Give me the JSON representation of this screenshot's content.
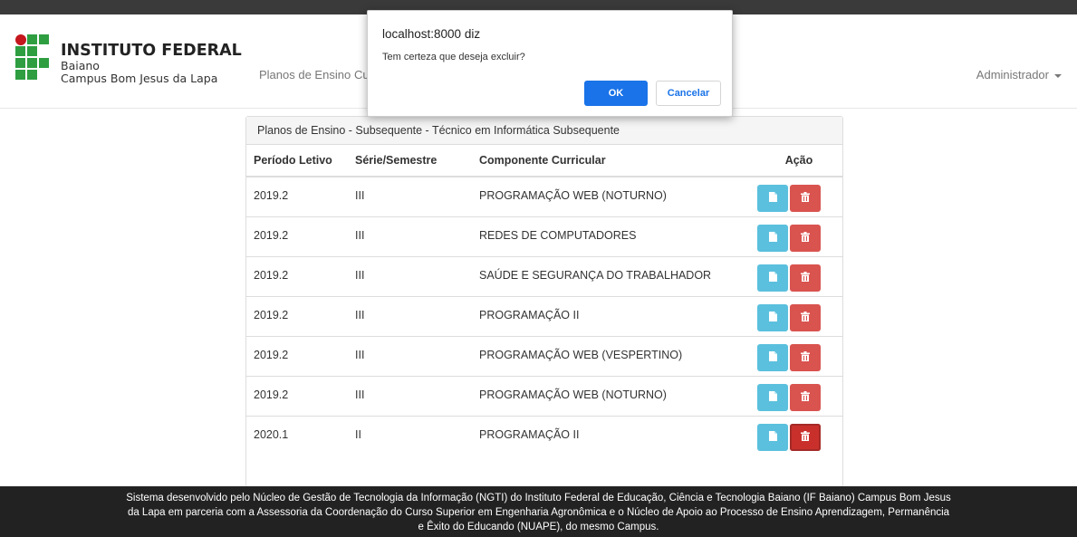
{
  "header": {
    "brand_title": "INSTITUTO FEDERAL",
    "brand_line1": "Baiano",
    "brand_line2": "Campus Bom Jesus da Lapa",
    "nav_item1": "Planos de Ensino",
    "nav_item2": "Cu",
    "user_menu": "Administrador"
  },
  "panel": {
    "title": "Planos de Ensino - Subsequente - Técnico em Informática Subsequente",
    "columns": [
      "Período Letivo",
      "Série/Semestre",
      "Componente Curricular",
      "Ação"
    ],
    "rows": [
      {
        "periodo": "2019.2",
        "serie": "III",
        "componente": "PROGRAMAÇÃO WEB (NOTURNO)"
      },
      {
        "periodo": "2019.2",
        "serie": "III",
        "componente": "REDES DE COMPUTADORES"
      },
      {
        "periodo": "2019.2",
        "serie": "III",
        "componente": "SAÚDE E SEGURANÇA DO TRABALHADOR"
      },
      {
        "periodo": "2019.2",
        "serie": "III",
        "componente": "PROGRAMAÇÃO II"
      },
      {
        "periodo": "2019.2",
        "serie": "III",
        "componente": "PROGRAMAÇÃO WEB (VESPERTINO)"
      },
      {
        "periodo": "2019.2",
        "serie": "III",
        "componente": "PROGRAMAÇÃO WEB (NOTURNO)"
      },
      {
        "periodo": "2020.1",
        "serie": "II",
        "componente": "PROGRAMAÇÃO II"
      }
    ]
  },
  "footer": {
    "line1": "Sistema desenvolvido pelo Núcleo de Gestão de Tecnologia da Informação (NGTI) do Instituto Federal de Educação, Ciência e Tecnologia Baiano (IF Baiano) Campus Bom Jesus",
    "line2": "da Lapa em parceria com a Assessoria da Coordenação do Curso Superior em Engenharia Agronômica e o Núcleo de Apoio ao Processo de Ensino Aprendizagem, Permanência",
    "line3": "e Êxito do Educando (NUAPE), do mesmo Campus."
  },
  "dialog": {
    "origin": "localhost:8000 diz",
    "message": "Tem certeza que deseja excluir?",
    "ok_label": "OK",
    "cancel_label": "Cancelar"
  },
  "icons": {
    "view": "file-icon",
    "delete": "trash-icon"
  },
  "colors": {
    "logo_green": "#2e9e41",
    "logo_red": "#c4161c",
    "info_button": "#5bc0de",
    "danger_button": "#d9534f",
    "dialog_ok": "#1a73e8"
  }
}
